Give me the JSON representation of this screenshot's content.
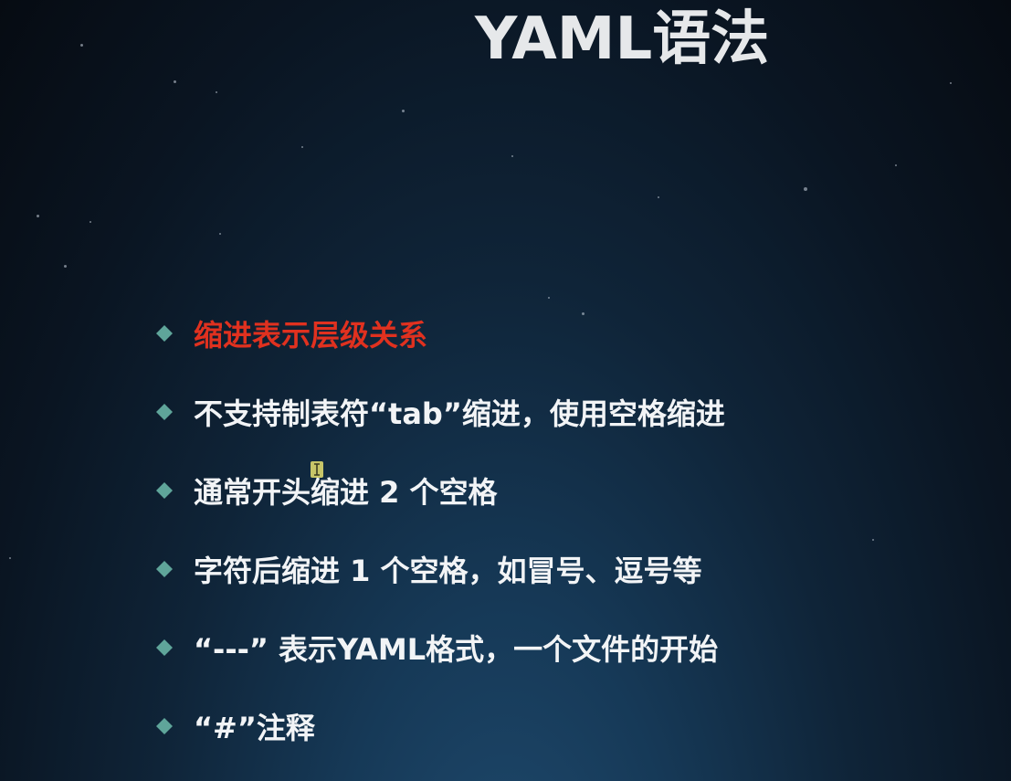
{
  "slide": {
    "title": "YAML语法",
    "bullets": [
      {
        "text": "缩进表示层级关系",
        "highlight": true
      },
      {
        "text": "不支持制表符“tab”缩进，使用空格缩进",
        "highlight": false
      },
      {
        "text": "通常开头缩进 2 个空格",
        "highlight": false
      },
      {
        "text": "字符后缩进 1 个空格，如冒号、逗号等",
        "highlight": false
      },
      {
        "text": "“---” 表示YAML格式，一个文件的开始",
        "highlight": false
      },
      {
        "text": "“#”注释",
        "highlight": false
      }
    ]
  },
  "icons": {
    "bullet": "diamond-bullet-icon",
    "cursor": "text-cursor-icon"
  },
  "colors": {
    "background": "#0a1522",
    "title": "#e6e8ea",
    "text": "#f2f4f6",
    "highlight": "#e0311f",
    "bullet": "#5fa59a"
  }
}
